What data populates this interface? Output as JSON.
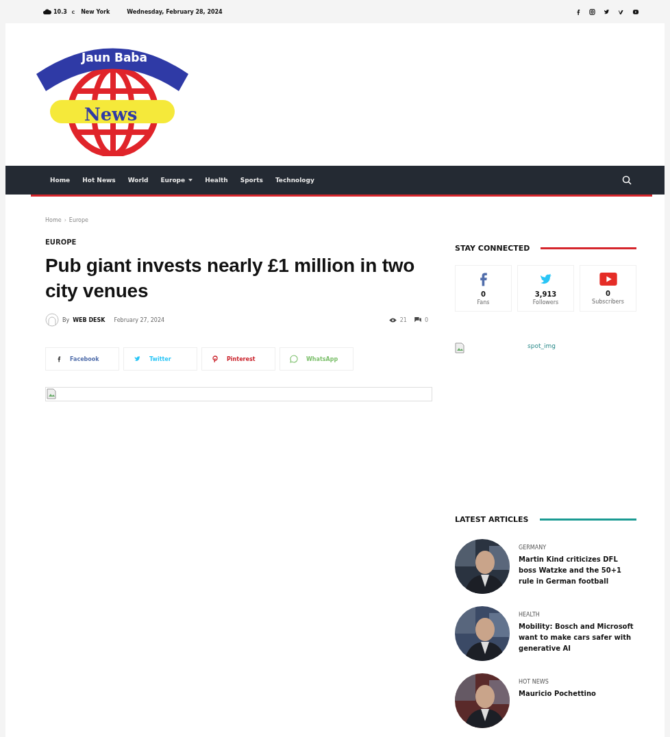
{
  "top_bar": {
    "temperature": "10.3",
    "unit": "C",
    "city": "New York",
    "date": "Wednesday, February 28, 2024"
  },
  "logo": {
    "ribbon": "Jaun Baba",
    "banner": "News"
  },
  "nav": {
    "items": [
      {
        "label": "Home",
        "has_dropdown": false
      },
      {
        "label": "Hot News",
        "has_dropdown": false
      },
      {
        "label": "World",
        "has_dropdown": false
      },
      {
        "label": "Europe",
        "has_dropdown": true
      },
      {
        "label": "Health",
        "has_dropdown": false
      },
      {
        "label": "Sports",
        "has_dropdown": false
      },
      {
        "label": "Technology",
        "has_dropdown": false
      }
    ]
  },
  "breadcrumb": {
    "separator": "›",
    "items": [
      "Home",
      "Europe"
    ]
  },
  "article": {
    "category": "EUROPE",
    "title": "Pub giant invests nearly £1 million in two city venues",
    "by": "By",
    "author": "WEB DESK",
    "date": "February 27, 2024",
    "views": "21",
    "comments": "0",
    "share": [
      {
        "kind": "facebook",
        "label": "Facebook",
        "color": "#516eab"
      },
      {
        "kind": "twitter",
        "label": "Twitter",
        "color": "#29c5f6"
      },
      {
        "kind": "pinterest",
        "label": "Pinterest",
        "color": "#ca212a"
      },
      {
        "kind": "whatsapp",
        "label": "WhatsApp",
        "color": "#7bbf6a"
      }
    ]
  },
  "stay_connected": {
    "title": "STAY CONNECTED",
    "items": [
      {
        "kind": "facebook",
        "count": "0",
        "label": "Fans"
      },
      {
        "kind": "twitter",
        "count": "3,913",
        "label": "Followers"
      },
      {
        "kind": "youtube",
        "count": "0",
        "label": "Subscribers"
      }
    ]
  },
  "ad": {
    "alt": "spot_img"
  },
  "latest": {
    "title": "LATEST ARTICLES",
    "items": [
      {
        "category": "GERMANY",
        "title": "Martin Kind criticizes DFL boss Watzke and the 50+1 rule in German football"
      },
      {
        "category": "HEALTH",
        "title": "Mobility: Bosch and Microsoft want to make cars safer with generative AI"
      },
      {
        "category": "HOT NEWS",
        "title": "Mauricio Pochettino"
      }
    ]
  }
}
